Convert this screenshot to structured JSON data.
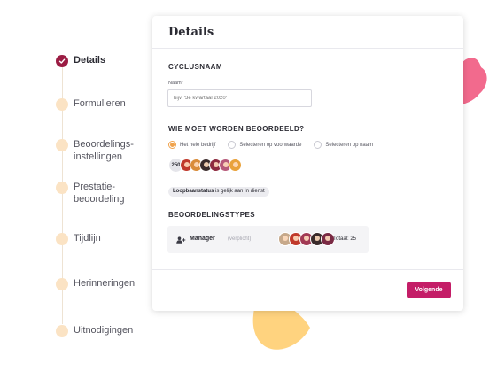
{
  "stepper": {
    "steps": [
      {
        "label": "Details",
        "state": "done"
      },
      {
        "label": "Formulieren",
        "state": "todo"
      },
      {
        "label": "Beoordelings-\ninstellingen",
        "state": "todo"
      },
      {
        "label": "Prestatie-\nbeoordeling",
        "state": "todo"
      },
      {
        "label": "Tijdlijn",
        "state": "todo"
      },
      {
        "label": "Herinneringen",
        "state": "todo"
      },
      {
        "label": "Uitnodigingen",
        "state": "todo"
      }
    ]
  },
  "card": {
    "title": "Details",
    "cycle_section": {
      "title": "CYCLUSNAAM",
      "name_label": "Naam*",
      "name_value": "",
      "name_placeholder": "bijv. '3e kwartaal 2020'"
    },
    "reviewees_section": {
      "title": "WIE MOET WORDEN BEOORDEELD?",
      "options": [
        {
          "label": "Het hele bedrijf",
          "selected": true
        },
        {
          "label": "Selecteren op voorwaarde",
          "selected": false
        },
        {
          "label": "Selecteren op naam",
          "selected": false
        }
      ],
      "count": "250",
      "condition_chip": {
        "field": "Loopbaanstatus",
        "rest": "is gelijk aan In dienst"
      }
    },
    "types_section": {
      "title": "BEOORDELINGSTYPES",
      "type": {
        "icon": "user-add-icon",
        "name": "Manager",
        "required": "(verplicht)",
        "total": "Totaal: 25"
      }
    },
    "next_button": "Volgende"
  },
  "colors": {
    "accent": "#c41d67",
    "done_step": "#9b1c43",
    "todo_step": "#fbe3c4",
    "radio_selected": "#f0a24b",
    "blob_pink": "#f26a8d",
    "blob_yellow": "#ffd37f"
  }
}
